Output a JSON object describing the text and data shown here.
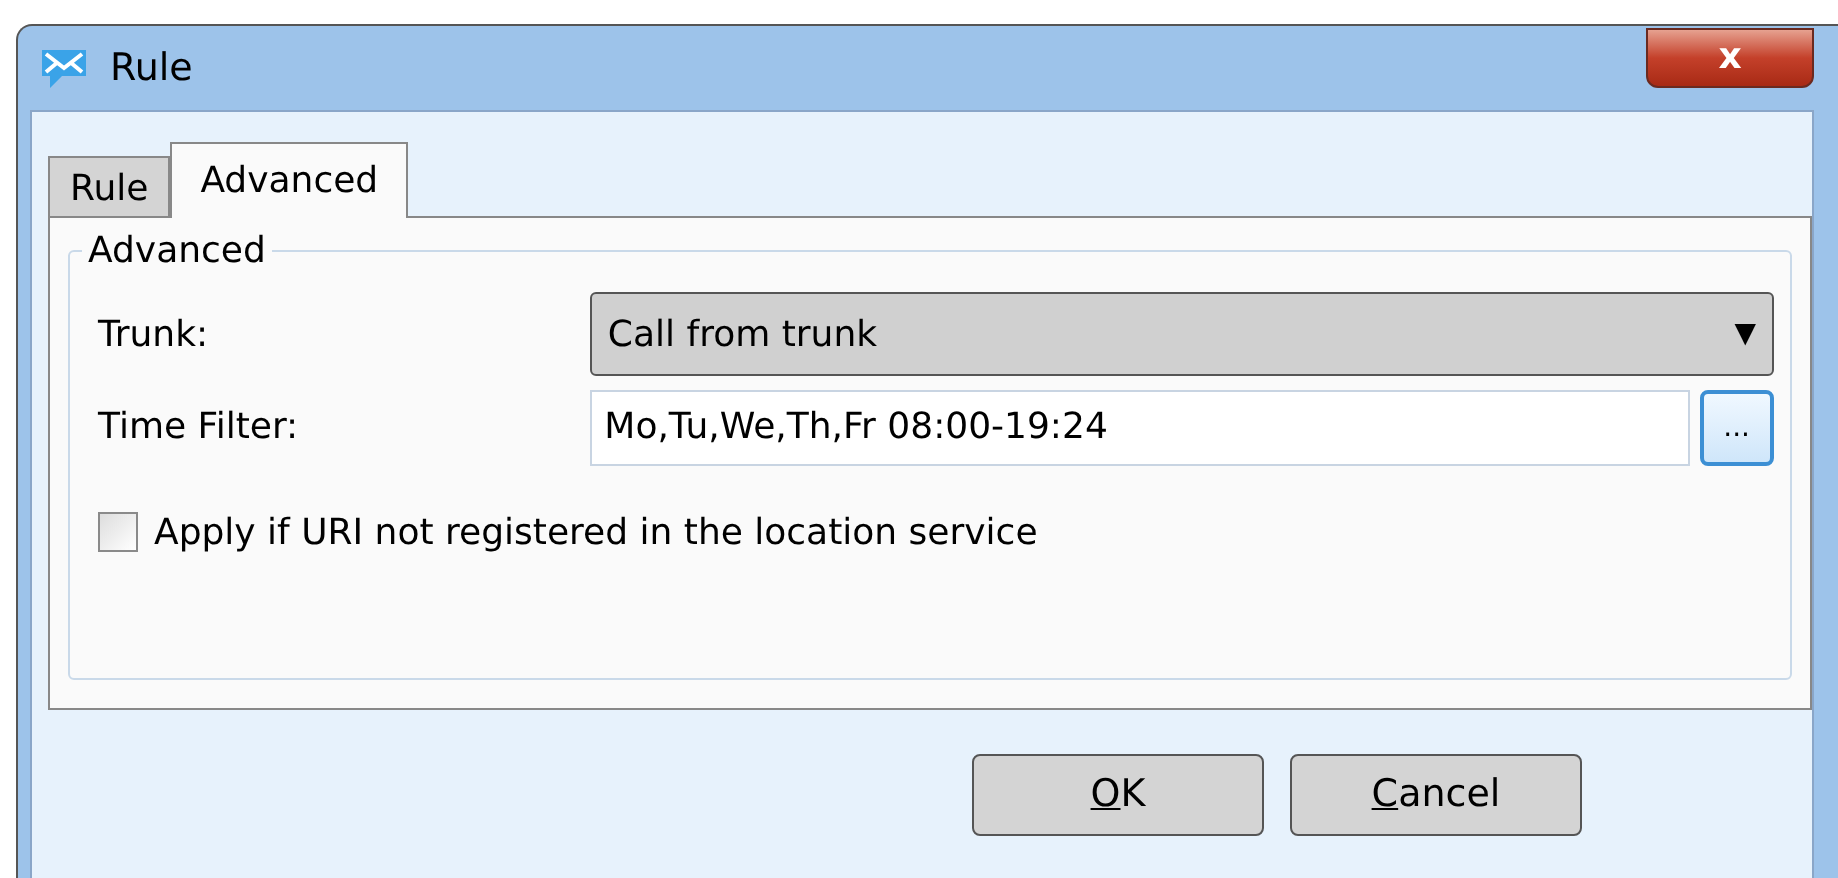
{
  "window": {
    "title": "Rule",
    "close_label": "x"
  },
  "tabs": [
    {
      "label": "Rule",
      "selected": false
    },
    {
      "label": "Advanced",
      "selected": true
    }
  ],
  "group": {
    "title": "Advanced"
  },
  "fields": [
    {
      "kind": "dropdown",
      "label": "Trunk:",
      "value": "Call from trunk",
      "caret": "▼"
    },
    {
      "kind": "browse",
      "label": "Time Filter:",
      "value": "Mo,Tu,We,Th,Fr 08:00-19:24",
      "button": "..."
    }
  ],
  "checkbox": {
    "label": "Apply if URI not registered in the location service",
    "checked": false
  },
  "buttons": [
    {
      "label": "OK",
      "mnemonic_underlined": true
    },
    {
      "label": "Cancel",
      "mnemonic_underlined": true
    }
  ]
}
